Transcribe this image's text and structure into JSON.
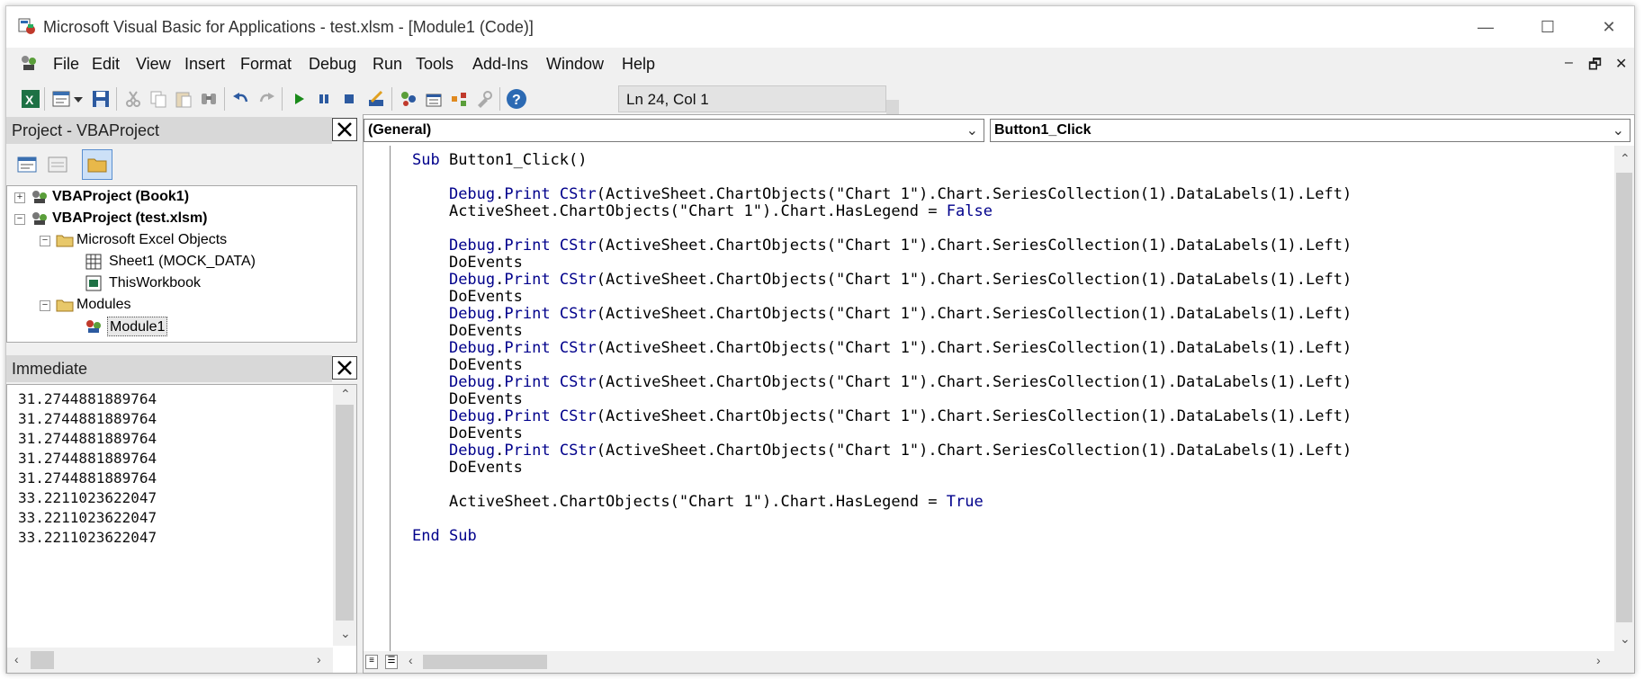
{
  "window": {
    "title": "Microsoft Visual Basic for Applications - test.xlsm - [Module1 (Code)]",
    "controls": {
      "minimize": "—",
      "maximize": "☐",
      "close": "✕"
    }
  },
  "menu": {
    "items": [
      "File",
      "Edit",
      "View",
      "Insert",
      "Format",
      "Debug",
      "Run",
      "Tools",
      "Add-Ins",
      "Window",
      "Help"
    ],
    "mdi_controls": {
      "minimize": "–",
      "restore": "🗗",
      "close": "✕"
    }
  },
  "toolbar": {
    "status": "Ln 24, Col 1",
    "icons": [
      "excel-icon",
      "insert-module-icon",
      "dropdown-icon",
      "save-icon",
      "cut-icon",
      "copy-icon",
      "paste-icon",
      "find-icon",
      "undo-icon",
      "redo-icon",
      "run-icon",
      "break-icon",
      "reset-icon",
      "design-mode-icon",
      "project-explorer-icon",
      "properties-icon",
      "object-browser-icon",
      "toolbox-icon",
      "help-icon"
    ]
  },
  "project": {
    "title": "Project - VBAProject",
    "tree": [
      {
        "label": "VBAProject (Book1)",
        "bold": true,
        "expander": "+"
      },
      {
        "label": "VBAProject (test.xlsm)",
        "bold": true,
        "expander": "−"
      },
      {
        "label": "Microsoft Excel Objects",
        "bold": false,
        "expander": "−"
      },
      {
        "label": "Sheet1 (MOCK_DATA)",
        "bold": false
      },
      {
        "label": "ThisWorkbook",
        "bold": false
      },
      {
        "label": "Modules",
        "bold": false,
        "expander": "−"
      },
      {
        "label": "Module1",
        "bold": false
      }
    ]
  },
  "immediate": {
    "title": "Immediate",
    "lines": [
      "31.2744881889764",
      "31.2744881889764",
      "31.2744881889764",
      "31.2744881889764",
      "31.2744881889764",
      "33.2211023622047",
      "33.2211023622047",
      "33.2211023622047"
    ]
  },
  "code": {
    "object_combo": "(General)",
    "procedure_combo": "Button1_Click",
    "lines": [
      "Sub Button1_Click()",
      "",
      "    Debug.Print CStr(ActiveSheet.ChartObjects(\"Chart 1\").Chart.SeriesCollection(1).DataLabels(1).Left)",
      "    ActiveSheet.ChartObjects(\"Chart 1\").Chart.HasLegend = False",
      "",
      "    Debug.Print CStr(ActiveSheet.ChartObjects(\"Chart 1\").Chart.SeriesCollection(1).DataLabels(1).Left)",
      "    DoEvents",
      "    Debug.Print CStr(ActiveSheet.ChartObjects(\"Chart 1\").Chart.SeriesCollection(1).DataLabels(1).Left)",
      "    DoEvents",
      "    Debug.Print CStr(ActiveSheet.ChartObjects(\"Chart 1\").Chart.SeriesCollection(1).DataLabels(1).Left)",
      "    DoEvents",
      "    Debug.Print CStr(ActiveSheet.ChartObjects(\"Chart 1\").Chart.SeriesCollection(1).DataLabels(1).Left)",
      "    DoEvents",
      "    Debug.Print CStr(ActiveSheet.ChartObjects(\"Chart 1\").Chart.SeriesCollection(1).DataLabels(1).Left)",
      "    DoEvents",
      "    Debug.Print CStr(ActiveSheet.ChartObjects(\"Chart 1\").Chart.SeriesCollection(1).DataLabels(1).Left)",
      "    DoEvents",
      "    Debug.Print CStr(ActiveSheet.ChartObjects(\"Chart 1\").Chart.SeriesCollection(1).DataLabels(1).Left)",
      "    DoEvents",
      "",
      "    ActiveSheet.ChartObjects(\"Chart 1\").Chart.HasLegend = True",
      "",
      "End Sub"
    ],
    "keywords": [
      "Sub",
      "End",
      "Debug",
      "Print",
      "CStr",
      "False",
      "True"
    ],
    "keyword_color": "#00008b"
  }
}
